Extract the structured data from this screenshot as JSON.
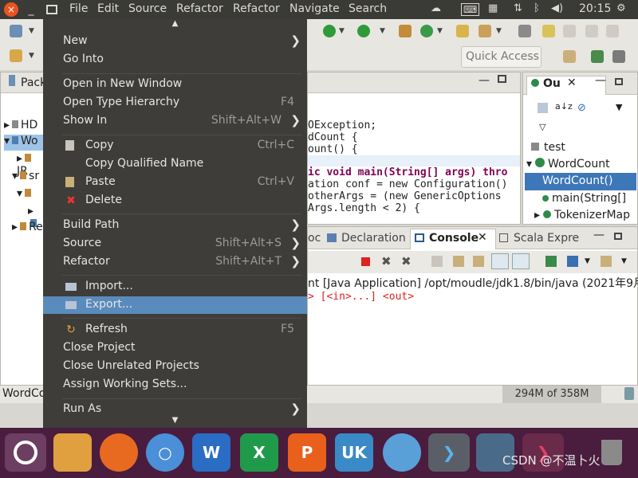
{
  "topbar": {
    "menus": [
      "File",
      "Edit",
      "Source",
      "Refactor",
      "Refactor",
      "Navigate",
      "Search"
    ],
    "time": "20:15",
    "close_icon": "×"
  },
  "toolbar": {
    "quick_access": "Quick Access"
  },
  "package_explorer": {
    "title": "Pack",
    "items": [
      "HD",
      "Wo",
      "JR",
      "sr",
      "Re"
    ]
  },
  "editor": {
    "lines": [
      "OException;",
      "dCount {",
      "ount() {",
      "",
      "ic void main(String[] args) thro",
      "ation conf = new Configuration()",
      " otherArgs = (new GenericOptions",
      "Args.length < 2) {"
    ]
  },
  "outline": {
    "tab": "Ou",
    "items": [
      "test",
      "WordCount",
      "WordCount()",
      "main(String[]",
      "TokenizerMap"
    ]
  },
  "bottom_tabs": {
    "doc": "oc",
    "declaration": "Declaration",
    "console": "Console",
    "scala": "Scala Expre"
  },
  "console": {
    "header": "nt [Java Application] /opt/moudle/jdk1.8/bin/java (2021年9月",
    "line": "> [<in>...] <out>"
  },
  "statusbar": {
    "left": "WordCo",
    "memory": "294M of 358M"
  },
  "menu": {
    "items": [
      {
        "label": "New",
        "submenu": true
      },
      {
        "label": "Go Into"
      },
      {
        "label": "Open in New Window"
      },
      {
        "label": "Open Type Hierarchy",
        "accel": "F4"
      },
      {
        "label": "Show In",
        "accel": "Shift+Alt+W",
        "submenu": true
      },
      {
        "label": "Copy",
        "accel": "Ctrl+C",
        "icon": "copy-icon"
      },
      {
        "label": "Copy Qualified Name",
        "icon": "copy-qualified-icon"
      },
      {
        "label": "Paste",
        "accel": "Ctrl+V",
        "icon": "paste-icon"
      },
      {
        "label": "Delete",
        "icon": "delete-icon"
      },
      {
        "label": "Build Path",
        "submenu": true
      },
      {
        "label": "Source",
        "accel": "Shift+Alt+S",
        "submenu": true
      },
      {
        "label": "Refactor",
        "accel": "Shift+Alt+T",
        "submenu": true
      },
      {
        "label": "Import...",
        "icon": "import-icon"
      },
      {
        "label": "Export...",
        "icon": "export-icon",
        "highlighted": true
      },
      {
        "label": "Refresh",
        "accel": "F5",
        "icon": "refresh-icon"
      },
      {
        "label": "Close Project"
      },
      {
        "label": "Close Unrelated Projects"
      },
      {
        "label": "Assign Working Sets..."
      },
      {
        "label": "Run As",
        "submenu": true
      }
    ]
  },
  "dock": {
    "watermark": "CSDN @不温卜火"
  },
  "colors": {
    "menu_bg": "#3e3d39",
    "menu_highlight": "#5a8bbd",
    "dock_bg": "#4a1c3e",
    "topbar_bg": "#3a3a37",
    "ubuntu_orange": "#e95420"
  }
}
